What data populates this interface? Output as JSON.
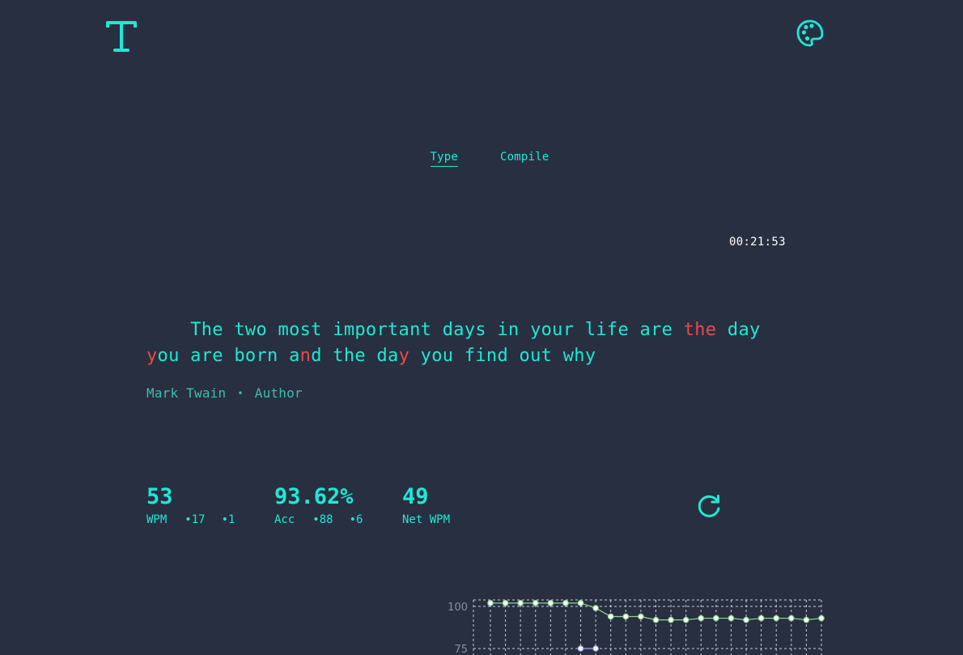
{
  "header": {
    "logo_icon": "letter-t-logo",
    "theme_icon": "palette-icon"
  },
  "tabs": [
    {
      "label": "Type",
      "active": true
    },
    {
      "label": "Compile",
      "active": false
    }
  ],
  "timer": "00:21:53",
  "quote": {
    "segments": [
      {
        "text": "The two most important days in your life are ",
        "error": false
      },
      {
        "text": "the",
        "error": true
      },
      {
        "text": " day ",
        "error": false
      },
      {
        "text": "y",
        "error": true
      },
      {
        "text": "ou are born a",
        "error": false
      },
      {
        "text": "n",
        "error": true
      },
      {
        "text": "d the da",
        "error": false
      },
      {
        "text": "y",
        "error": true
      },
      {
        "text": " you find out why",
        "error": false
      }
    ],
    "author": "Mark Twain",
    "separator": "•",
    "role": "Author"
  },
  "stats": {
    "wpm": {
      "value": "53",
      "label": "WPM",
      "correct": "•17",
      "incorrect": "•1"
    },
    "accuracy": {
      "value": "93.62%",
      "label": "Acc",
      "correct": "•88",
      "incorrect": "•6"
    },
    "net_wpm": {
      "value": "49",
      "label": "Net WPM"
    }
  },
  "reload_icon": "reload-icon",
  "colors": {
    "background": "#282f40",
    "accent": "#1de9d5",
    "error": "#e84b45",
    "author": "#3dbdb0",
    "series_wpm": "#8fd694",
    "series_secondary": "#a9a4f5"
  },
  "chart_data": {
    "type": "line",
    "ytick_labels": [
      "100",
      "75"
    ],
    "grid": true,
    "series": [
      {
        "values": [
          102,
          102,
          102,
          102,
          102,
          102,
          102,
          99,
          94,
          94,
          94,
          92,
          92,
          92,
          93,
          93,
          93,
          92,
          93,
          93,
          93,
          92,
          93
        ]
      },
      {
        "values": [
          null,
          null,
          null,
          null,
          null,
          null,
          75,
          75,
          null,
          null,
          null,
          null,
          null,
          null,
          null,
          null,
          null,
          null,
          null,
          null,
          null,
          null,
          null
        ]
      }
    ]
  }
}
